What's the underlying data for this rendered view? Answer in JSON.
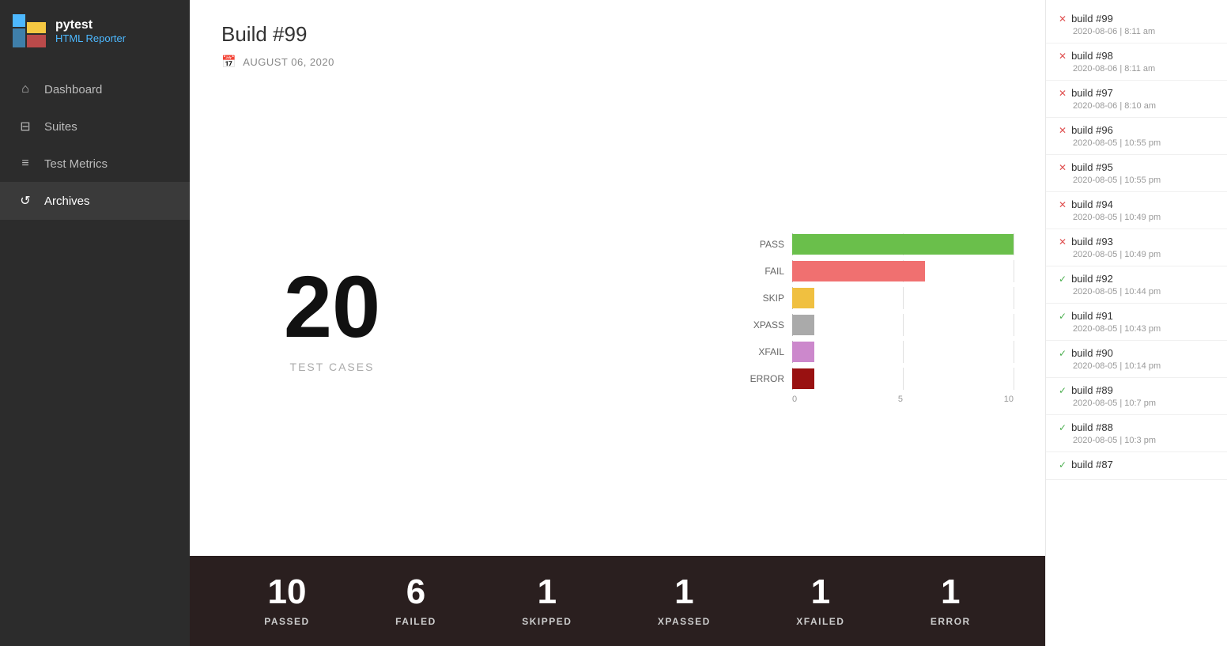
{
  "sidebar": {
    "logo": {
      "pytest": "pytest",
      "reporter": "HTML Reporter"
    },
    "nav_items": [
      {
        "id": "dashboard",
        "label": "Dashboard",
        "icon": "⌂",
        "active": false
      },
      {
        "id": "suites",
        "label": "Suites",
        "icon": "⊟",
        "active": false
      },
      {
        "id": "test-metrics",
        "label": "Test Metrics",
        "icon": "≡",
        "active": false
      },
      {
        "id": "archives",
        "label": "Archives",
        "icon": "↺",
        "active": true
      }
    ]
  },
  "build": {
    "title": "Build #99",
    "date": "AUGUST 06, 2020",
    "total_tests": "20",
    "test_cases_label": "TEST CASES"
  },
  "chart": {
    "max_value": 10,
    "labels": [
      "PASS",
      "FAIL",
      "SKIP",
      "XPASS",
      "XFAIL",
      "ERROR"
    ],
    "values": [
      10,
      6,
      1,
      1,
      1,
      1
    ],
    "colors": [
      "#6abf4b",
      "#f07070",
      "#f0c040",
      "#aaaaaa",
      "#cc88cc",
      "#991111"
    ],
    "axis_labels": [
      "0",
      "5",
      "10"
    ]
  },
  "stats": [
    {
      "number": "10",
      "label": "PASSED"
    },
    {
      "number": "6",
      "label": "FAILED"
    },
    {
      "number": "1",
      "label": "SKIPPED"
    },
    {
      "number": "1",
      "label": "XPASSED"
    },
    {
      "number": "1",
      "label": "XFAILED"
    },
    {
      "number": "1",
      "label": "ERROR"
    }
  ],
  "build_list": [
    {
      "id": "build99",
      "name": "build #99",
      "date": "2020-08-06 | 8:11 am",
      "status": "fail"
    },
    {
      "id": "build98",
      "name": "build #98",
      "date": "2020-08-06 | 8:11 am",
      "status": "fail"
    },
    {
      "id": "build97",
      "name": "build #97",
      "date": "2020-08-06 | 8:10 am",
      "status": "fail"
    },
    {
      "id": "build96",
      "name": "build #96",
      "date": "2020-08-05 | 10:55 pm",
      "status": "fail"
    },
    {
      "id": "build95",
      "name": "build #95",
      "date": "2020-08-05 | 10:55 pm",
      "status": "fail"
    },
    {
      "id": "build94",
      "name": "build #94",
      "date": "2020-08-05 | 10:49 pm",
      "status": "fail"
    },
    {
      "id": "build93",
      "name": "build #93",
      "date": "2020-08-05 | 10:49 pm",
      "status": "fail"
    },
    {
      "id": "build92",
      "name": "build #92",
      "date": "2020-08-05 | 10:44 pm",
      "status": "pass"
    },
    {
      "id": "build91",
      "name": "build #91",
      "date": "2020-08-05 | 10:43 pm",
      "status": "pass"
    },
    {
      "id": "build90",
      "name": "build #90",
      "date": "2020-08-05 | 10:14 pm",
      "status": "pass"
    },
    {
      "id": "build89",
      "name": "build #89",
      "date": "2020-08-05 | 10:7 pm",
      "status": "pass"
    },
    {
      "id": "build88",
      "name": "build #88",
      "date": "2020-08-05 | 10:3 pm",
      "status": "pass"
    },
    {
      "id": "build87",
      "name": "build #87",
      "date": "",
      "status": "pass"
    }
  ]
}
